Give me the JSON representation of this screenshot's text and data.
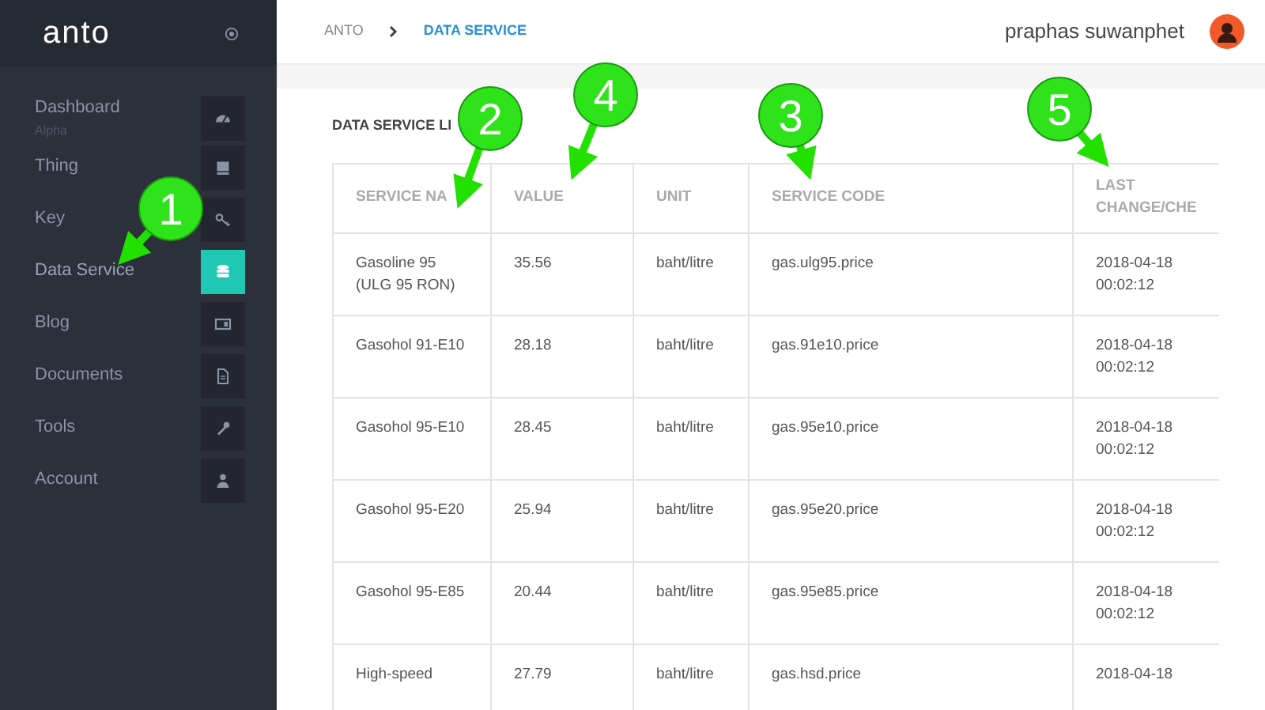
{
  "sidebar": {
    "logo": "anto",
    "items": [
      {
        "label": "Dashboard",
        "sublabel": "Alpha",
        "selected": false
      },
      {
        "label": "Thing",
        "selected": false
      },
      {
        "label": "Key",
        "selected": false
      },
      {
        "label": "Data Service",
        "selected": true
      },
      {
        "label": "Blog",
        "selected": false
      },
      {
        "label": "Documents",
        "selected": false
      },
      {
        "label": "Tools",
        "selected": false
      },
      {
        "label": "Account",
        "selected": false
      }
    ]
  },
  "breadcrumb": [
    {
      "label": "ANTO",
      "selected": false
    },
    {
      "label": "DATA SERVICE",
      "selected": true
    }
  ],
  "user": {
    "name": "praphas suwanphet"
  },
  "section_title": "DATA SERVICE LI",
  "table": {
    "columns": [
      "SERVICE NA",
      "VALUE",
      "UNIT",
      "SERVICE CODE",
      "LAST CHANGE/CHE"
    ],
    "rows": [
      [
        "Gasoline 95 (ULG 95 RON)",
        "35.56",
        "baht/litre",
        "gas.ulg95.price",
        "2018-04-18 00:02:12"
      ],
      [
        "Gasohol 91-E10",
        "28.18",
        "baht/litre",
        "gas.91e10.price",
        "2018-04-18 00:02:12"
      ],
      [
        "Gasohol 95-E10",
        "28.45",
        "baht/litre",
        "gas.95e10.price",
        "2018-04-18 00:02:12"
      ],
      [
        "Gasohol 95-E20",
        "25.94",
        "baht/litre",
        "gas.95e20.price",
        "2018-04-18 00:02:12"
      ],
      [
        "Gasohol 95-E85",
        "20.44",
        "baht/litre",
        "gas.95e85.price",
        "2018-04-18 00:02:12"
      ],
      [
        "High-speed",
        "27.79",
        "baht/litre",
        "gas.hsd.price",
        "2018-04-18"
      ]
    ]
  },
  "callouts": [
    {
      "number": "1"
    },
    {
      "number": "2"
    },
    {
      "number": "4"
    },
    {
      "number": "3"
    },
    {
      "number": "5"
    }
  ]
}
